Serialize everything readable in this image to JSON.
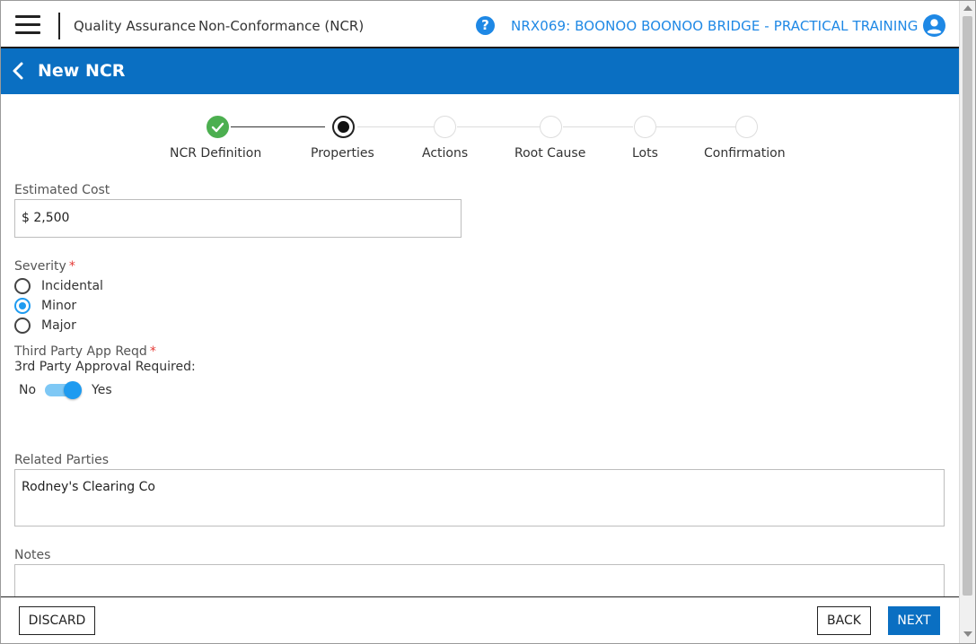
{
  "header": {
    "breadcrumb_module": "Quality Assurance",
    "breadcrumb_page": "Non-Conformance (NCR)",
    "help_glyph": "?",
    "project": "NRX069: BOONOO BOONOO BRIDGE - PRACTICAL TRAINING",
    "icons": [
      "hamburger-menu-icon",
      "help-icon",
      "user-account-icon"
    ]
  },
  "titlebar": {
    "title": "New NCR",
    "back_icon": "chevron-left-icon"
  },
  "stepper": {
    "steps": [
      {
        "label": "NCR Definition",
        "state": "done"
      },
      {
        "label": "Properties",
        "state": "current"
      },
      {
        "label": "Actions",
        "state": "pending"
      },
      {
        "label": "Root Cause",
        "state": "pending"
      },
      {
        "label": "Lots",
        "state": "pending"
      },
      {
        "label": "Confirmation",
        "state": "pending"
      }
    ]
  },
  "form": {
    "estimated_cost": {
      "label": "Estimated Cost",
      "value": "$ 2,500"
    },
    "severity": {
      "label": "Severity",
      "required_mark": "*",
      "options": [
        "Incidental",
        "Minor",
        "Major"
      ],
      "selected": "Minor"
    },
    "third_party": {
      "label": "Third Party App Reqd",
      "required_mark": "*",
      "sub_label": "3rd Party Approval Required:",
      "off_label": "No",
      "on_label": "Yes",
      "value": "Yes"
    },
    "related_parties": {
      "label": "Related Parties",
      "value": "Rodney's Clearing Co"
    },
    "notes": {
      "label": "Notes",
      "value": ""
    }
  },
  "footer": {
    "discard_label": "DISCARD",
    "back_label": "BACK",
    "next_label": "NEXT"
  },
  "colors": {
    "primary": "#0a6fc2",
    "accent": "#1e9bf0",
    "success": "#4caf50",
    "required": "#e53935"
  }
}
